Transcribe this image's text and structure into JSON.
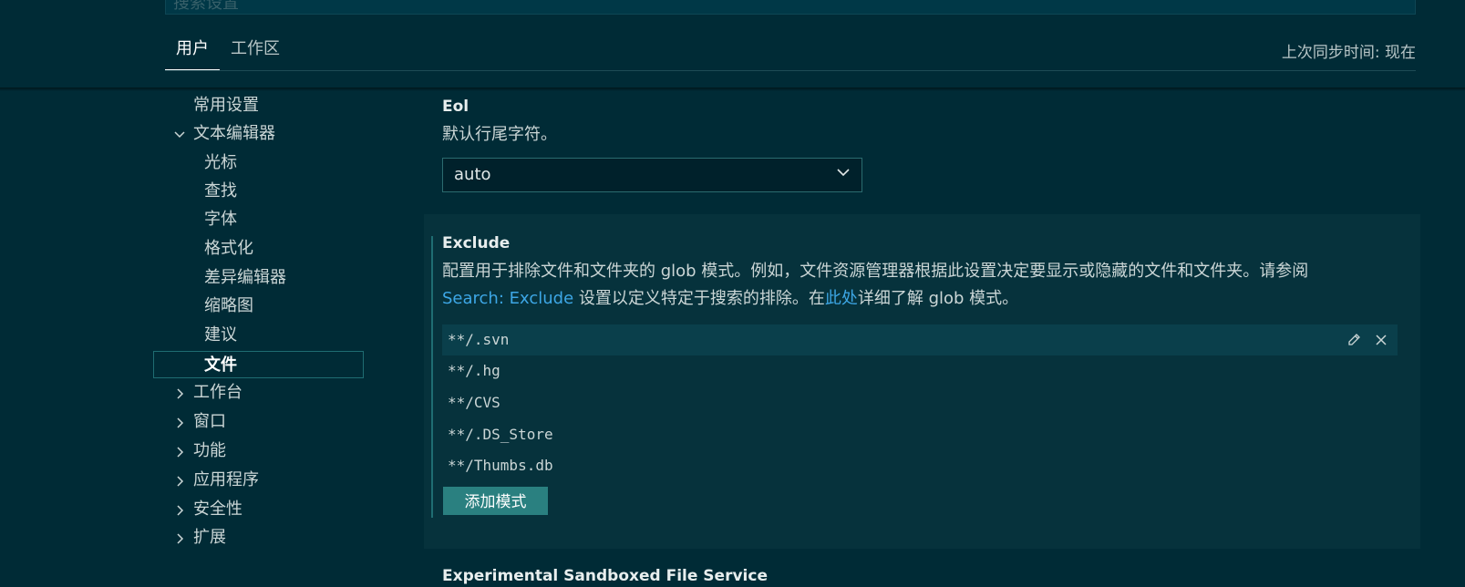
{
  "header": {
    "search_placeholder": "搜索设置",
    "tabs": [
      "用户",
      "工作区"
    ],
    "sync_status": "上次同步时间: 现在"
  },
  "sidebar": {
    "items": [
      {
        "label": "常用设置"
      },
      {
        "label": "文本编辑器",
        "expanded": true
      },
      {
        "label": "光标"
      },
      {
        "label": "查找"
      },
      {
        "label": "字体"
      },
      {
        "label": "格式化"
      },
      {
        "label": "差异编辑器"
      },
      {
        "label": "缩略图"
      },
      {
        "label": "建议"
      },
      {
        "label": "文件",
        "selected": true
      },
      {
        "label": "工作台"
      },
      {
        "label": "窗口"
      },
      {
        "label": "功能"
      },
      {
        "label": "应用程序"
      },
      {
        "label": "安全性"
      },
      {
        "label": "扩展"
      }
    ]
  },
  "settings": {
    "eol": {
      "title": "Eol",
      "description": "默认行尾字符。",
      "value": "auto"
    },
    "exclude": {
      "title": "Exclude",
      "desc_line1": "配置用于排除文件和文件夹的 glob 模式。例如，文件资源管理器根据此设置决定要显示或隐藏的文件和文件夹。请参阅",
      "desc_link1": "Search: Exclude",
      "desc_mid": " 设置以定义特定于搜索的排除。在",
      "desc_link2": "此处",
      "desc_end": "详细了解 glob 模式。",
      "patterns": [
        "**/.svn",
        "**/.hg",
        "**/CVS",
        "**/.DS_Store",
        "**/Thumbs.db"
      ],
      "add_label": "添加模式"
    },
    "next_title": "Experimental Sandboxed File Service"
  },
  "colors": {
    "background": "#002b36",
    "accent": "#2a8080",
    "link": "#3da7e6"
  }
}
